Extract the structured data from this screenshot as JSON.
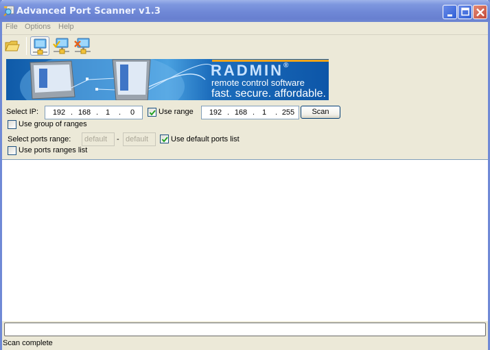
{
  "window": {
    "title": "Advanced Port Scanner v1.3",
    "controls": {
      "minimize": "minimize",
      "maximize": "maximize",
      "close": "close"
    }
  },
  "menu": {
    "items": [
      {
        "label": "File"
      },
      {
        "label": "Options"
      },
      {
        "label": "Help"
      }
    ]
  },
  "toolbar": {
    "buttons": [
      {
        "icon": "folder-open-icon",
        "tooltip": ""
      },
      {
        "icon": "network-computer-icon",
        "pressed": true
      },
      {
        "icon": "network-computer-check-icon",
        "pressed": false
      },
      {
        "icon": "network-computer-cross-icon",
        "pressed": false
      }
    ]
  },
  "banner": {
    "brand": "RADMIN",
    "registered": "®",
    "line2": "remote control software",
    "line3": "fast. secure. affordable."
  },
  "ip_range": {
    "select_ip_label": "Select IP:",
    "start_ip": [
      "192",
      "168",
      "1",
      "0"
    ],
    "use_range_label": "Use range",
    "use_range_checked": true,
    "end_ip": [
      "192",
      "168",
      "1",
      "255"
    ],
    "dot": ".",
    "scan_label": "Scan",
    "use_group_label": "Use group of ranges",
    "use_group_checked": false
  },
  "ports": {
    "select_ports_label": "Select ports range:",
    "from_placeholder": "default",
    "separator": "-",
    "to_placeholder": "default",
    "use_default_label": "Use default ports list",
    "use_default_checked": true,
    "use_ranges_list_label": "Use ports ranges list",
    "use_ranges_list_checked": false
  },
  "progress": {
    "value": 0
  },
  "status": {
    "text": "Scan complete"
  },
  "colors": {
    "titlebar": "#6f88d6",
    "window_bg": "#ece9d8",
    "banner_blue": "#1d6ebd",
    "banner_orange": "#f2a51a",
    "check_green": "#21a121"
  }
}
